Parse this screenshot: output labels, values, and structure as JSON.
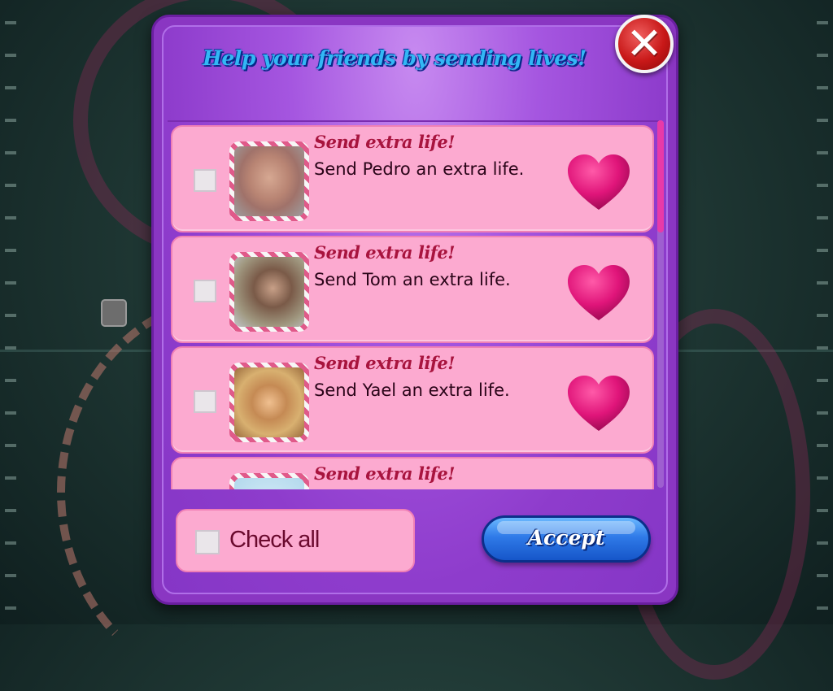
{
  "dialog": {
    "title": "Help your friends by sending lives!",
    "close_icon": "close-icon"
  },
  "friends": [
    {
      "heading": "Send extra life!",
      "message": "Send Pedro an extra life.",
      "checked": false,
      "icon": "heart-icon"
    },
    {
      "heading": "Send extra life!",
      "message": "Send Tom an extra life.",
      "checked": false,
      "icon": "heart-icon"
    },
    {
      "heading": "Send extra life!",
      "message": "Send Yael an extra life.",
      "checked": false,
      "icon": "heart-icon"
    },
    {
      "heading": "Send extra life!",
      "message": "",
      "checked": false,
      "icon": "heart-icon"
    }
  ],
  "footer": {
    "check_all_label": "Check all",
    "accept_label": "Accept"
  },
  "colors": {
    "dialog_purple": "#8e3ccc",
    "row_pink": "#fcaad0",
    "title_blue": "#33b7f5",
    "heart_magenta": "#e0157a",
    "accept_blue": "#2f7ae8",
    "close_red": "#c81818"
  }
}
